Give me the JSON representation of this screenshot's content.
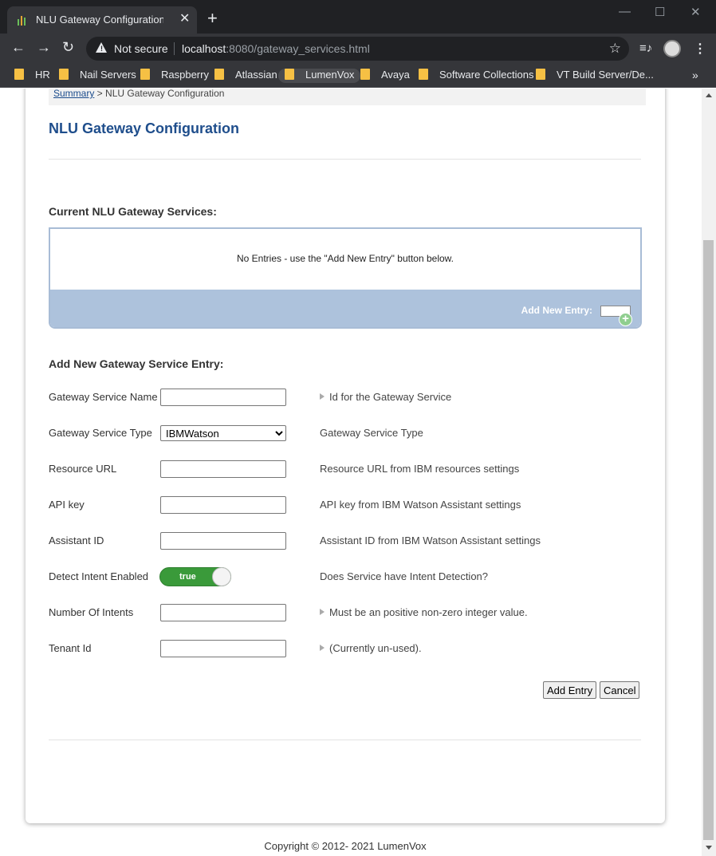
{
  "browser": {
    "tab_title": "NLU Gateway Configuration - LumenVox",
    "security_label": "Not secure",
    "url_host": "localhost",
    "url_rest": ":8080/gateway_services.html",
    "bookmarks": [
      "HR",
      "Nail Servers",
      "Raspberry",
      "Atlassian",
      "LumenVox",
      "Avaya",
      "Software Collections",
      "VT Build Server/De..."
    ],
    "bookmark_overflow": "»"
  },
  "breadcrumb": {
    "link": "Summary",
    "separator": " > ",
    "current": "NLU Gateway Configuration"
  },
  "page_title": "NLU Gateway Configuration",
  "current_services": {
    "heading": "Current NLU Gateway Services:",
    "empty_text": "No Entries - use the \"Add New Entry\" button below.",
    "add_label": "Add New Entry:"
  },
  "form": {
    "heading": "Add New Gateway Service Entry:",
    "fields": [
      {
        "label": "Gateway Service Name",
        "value": "",
        "help": "Id for the Gateway Service"
      },
      {
        "label": "Gateway Service Type",
        "value": "IBMWatson",
        "help": "Gateway Service Type"
      },
      {
        "label": "Resource URL",
        "value": "",
        "help": "Resource URL from IBM resources settings"
      },
      {
        "label": "API key",
        "value": "",
        "help": "API key from IBM Watson Assistant settings"
      },
      {
        "label": "Assistant ID",
        "value": "",
        "help": "Assistant ID from IBM Watson Assistant settings"
      },
      {
        "label": "Detect Intent Enabled",
        "value": "true",
        "help": "Does Service have Intent Detection?"
      },
      {
        "label": "Number Of Intents",
        "value": "",
        "help": "Must be an positive non-zero integer value."
      },
      {
        "label": "Tenant Id",
        "value": "",
        "help": "(Currently un-used)."
      }
    ],
    "add_button": "Add Entry",
    "cancel_button": "Cancel"
  },
  "footer": "Copyright © 2012- 2021 LumenVox",
  "colors": {
    "title_blue": "#1f4e8c",
    "panel_blue": "#adc2dc",
    "toggle_green": "#3a9a3a"
  }
}
